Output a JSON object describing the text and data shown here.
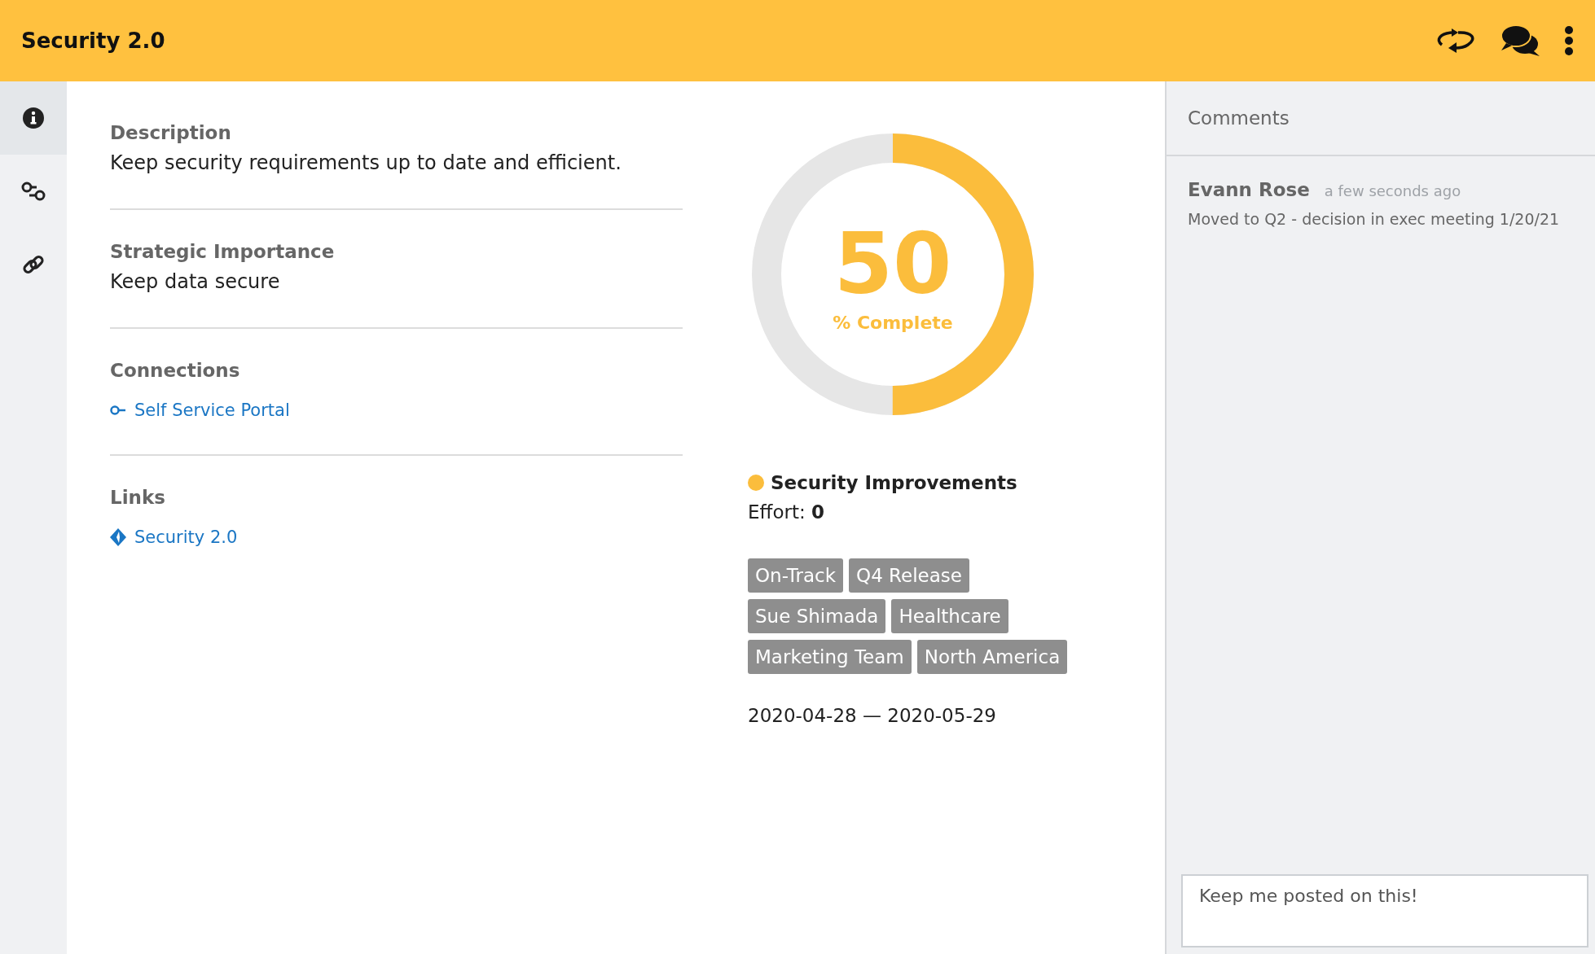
{
  "header": {
    "title": "Security 2.0"
  },
  "sidebar": {
    "items": [
      {
        "kind": "info",
        "selected": true
      },
      {
        "kind": "connections",
        "selected": false
      },
      {
        "kind": "links",
        "selected": false
      }
    ]
  },
  "details": {
    "description": {
      "label": "Description",
      "text": "Keep security requirements up to date and efficient."
    },
    "strategic_importance": {
      "label": "Strategic Importance",
      "text": "Keep data secure"
    },
    "connections": {
      "label": "Connections",
      "items": [
        "Self Service Portal"
      ]
    },
    "links": {
      "label": "Links",
      "items": [
        "Security 2.0"
      ]
    }
  },
  "progress": {
    "value": "50",
    "caption": "% Complete",
    "level": 0.5
  },
  "initiative": {
    "name": "Security Improvements",
    "color": "#fbbd3c",
    "effort_label": "Effort:",
    "effort": "0"
  },
  "tags": [
    "On-Track",
    "Q4 Release",
    "Sue Shimada",
    "Healthcare",
    "Marketing Team",
    "North America"
  ],
  "dates": "2020-04-28 — 2020-05-29",
  "comments": {
    "title": "Comments",
    "items": [
      {
        "author": "Evann Rose",
        "time": "a few seconds ago",
        "text": "Moved to Q2 - decision in exec meeting 1/20/21"
      }
    ],
    "input": {
      "value": "Keep me posted on this!"
    }
  }
}
